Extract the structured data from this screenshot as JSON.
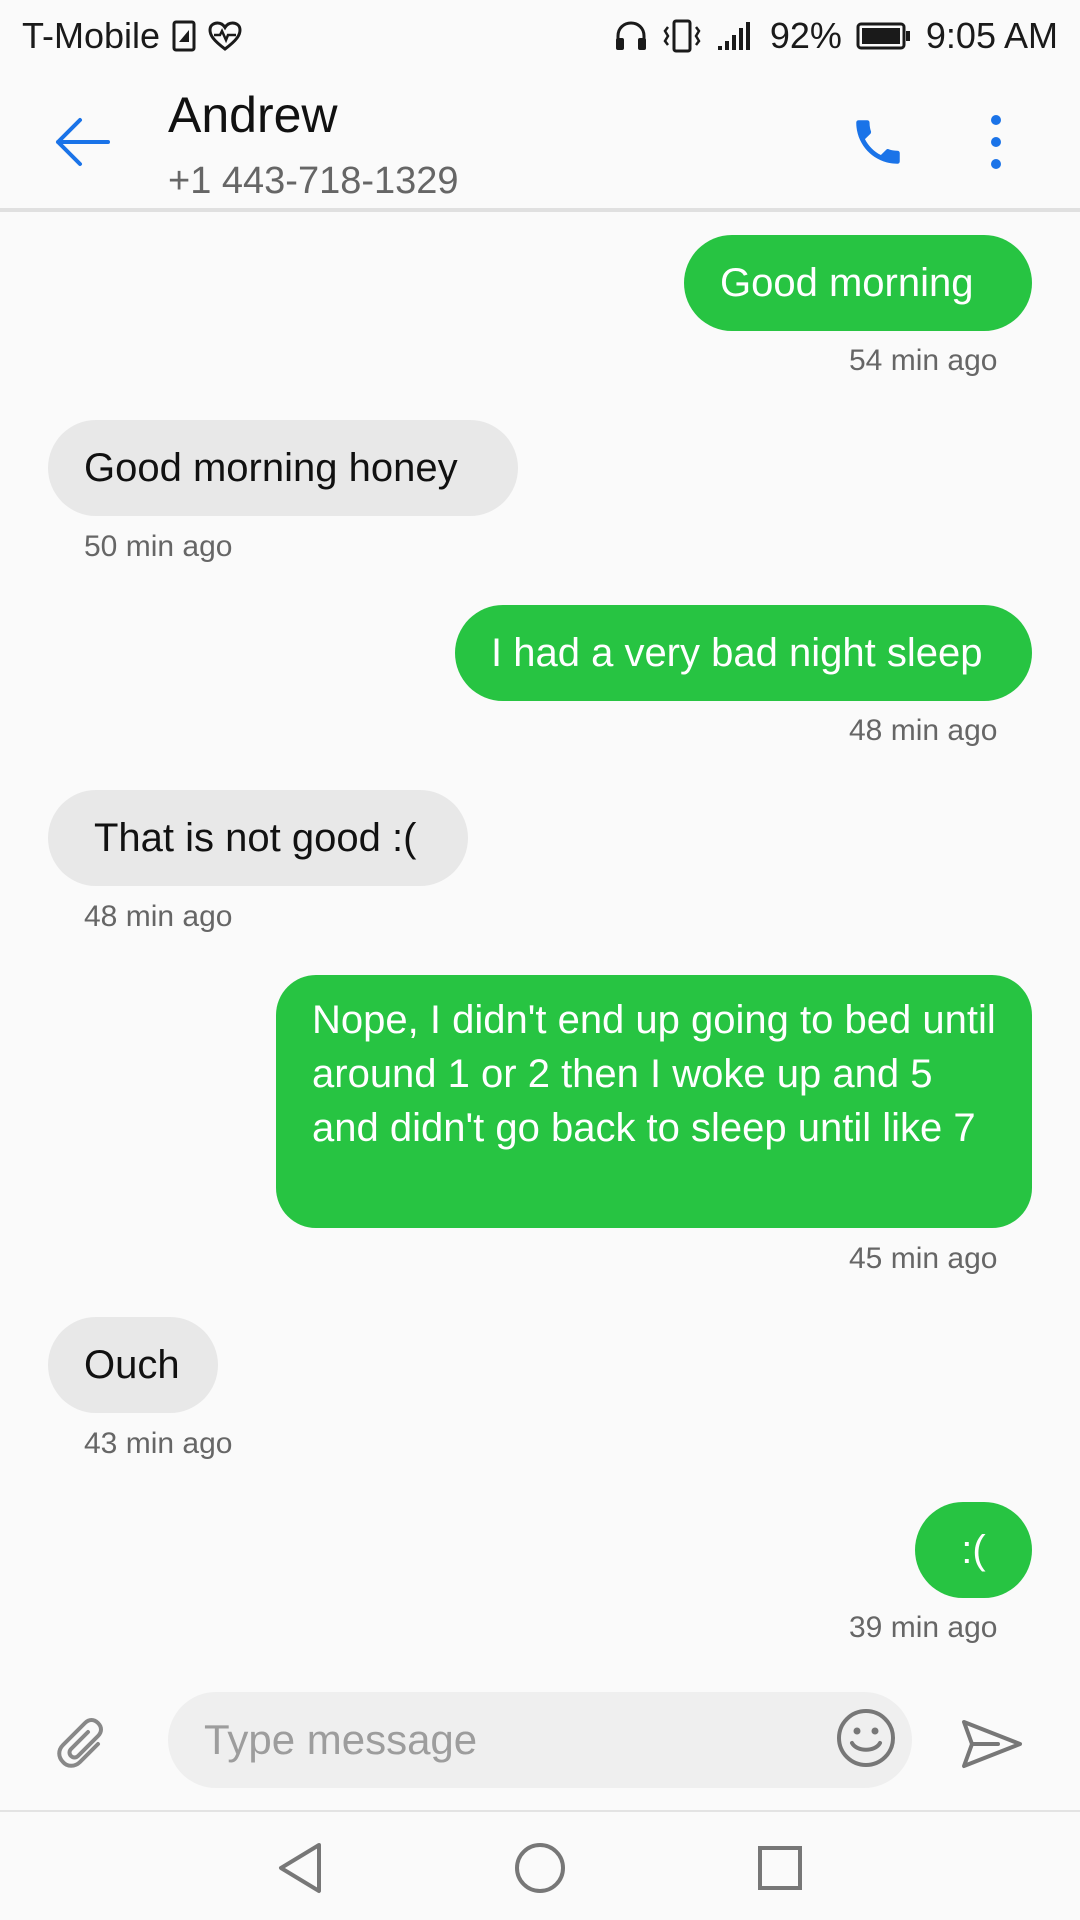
{
  "status_bar": {
    "carrier": "T-Mobile",
    "battery_percent": "92%",
    "time": "9:05 AM",
    "icons": [
      "sim-card-icon",
      "heart-pulse-icon",
      "headphones-icon",
      "vibrate-icon",
      "signal-icon",
      "battery-icon"
    ]
  },
  "header": {
    "contact_name": "Andrew",
    "contact_number": "+1 443-718-1329",
    "icons": [
      "back-arrow-icon",
      "phone-icon",
      "more-vertical-icon"
    ]
  },
  "messages": [
    {
      "direction": "outgoing",
      "text": "Good morning",
      "time": "54 min ago"
    },
    {
      "direction": "incoming",
      "text": "Good morning honey",
      "time": "50 min ago"
    },
    {
      "direction": "outgoing",
      "text": "I had a very bad night sleep",
      "time": "48 min ago"
    },
    {
      "direction": "incoming",
      "text": "That is not good :(",
      "time": "48 min ago"
    },
    {
      "direction": "outgoing",
      "text": "Nope, I didn't end up going to bed until around 1 or 2 then I woke up and 5 and didn't go back to sleep until like 7",
      "time": "45 min ago"
    },
    {
      "direction": "incoming",
      "text": "Ouch",
      "time": "43 min ago"
    },
    {
      "direction": "outgoing",
      "text": ":(",
      "time": "39 min ago"
    }
  ],
  "composer": {
    "placeholder": "Type message",
    "value": "",
    "icons": [
      "paperclip-icon",
      "emoji-icon",
      "send-icon"
    ]
  },
  "nav_bar": {
    "icons": [
      "nav-back-icon",
      "nav-home-icon",
      "nav-recent-apps-icon"
    ]
  },
  "colors": {
    "outgoing_bubble": "#27c442",
    "incoming_bubble": "#e8e8e8",
    "accent": "#1a73e8",
    "background": "#fafafa"
  }
}
